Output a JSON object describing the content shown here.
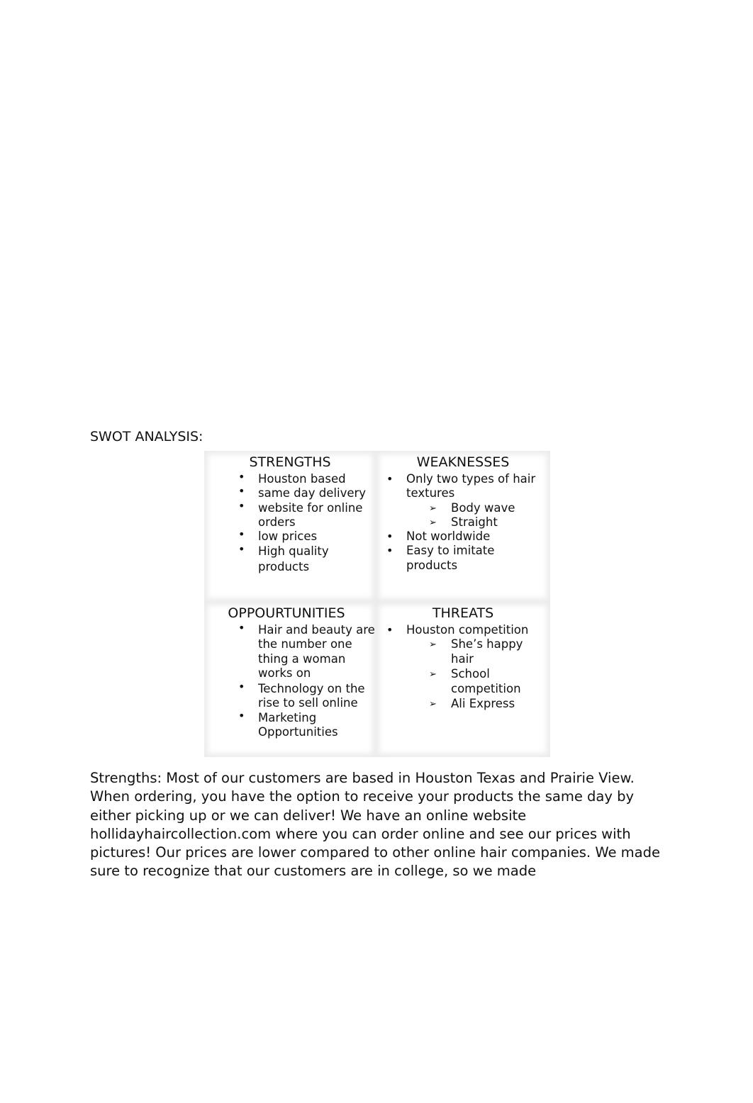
{
  "swot": {
    "heading": "SWOT ANALYSIS:",
    "strengths": {
      "title": "STRENGTHS",
      "items": [
        {
          "text": "Houston based"
        },
        {
          "text": "same day delivery"
        },
        {
          "text": "website for online orders"
        },
        {
          "text": "low prices"
        },
        {
          "text": "High quality products"
        }
      ]
    },
    "weaknesses": {
      "title": "WEAKNESSES",
      "items": [
        {
          "text": "Only two types of hair textures",
          "sub": [
            "Body wave",
            "Straight"
          ]
        },
        {
          "text": "Not worldwide"
        },
        {
          "text": "Easy to imitate products"
        }
      ]
    },
    "opportunities": {
      "title": "OPPOURTUNITIES",
      "items": [
        {
          "text": "Hair and beauty are the number one thing a woman works on"
        },
        {
          "text": "Technology on the rise to sell online"
        },
        {
          "text": "Marketing Opportunities"
        }
      ]
    },
    "threats": {
      "title": "THREATS",
      "items": [
        {
          "text": "Houston competition",
          "sub": [
            "She’s happy hair",
            "School competition",
            "Ali Express"
          ]
        }
      ]
    }
  },
  "bullet_glyph": "•",
  "arrow_glyph": "➢",
  "body": {
    "paragraph": "Strengths: Most of our customers are based in Houston Texas and Prairie View. When ordering, you have the option to receive your products the same day by either picking up or we can deliver! We have an online website hollidayhaircollection.com where you can order online and see our prices with pictures! Our prices are lower compared to other online hair companies. We made sure to recognize that our customers are in college, so we made"
  }
}
